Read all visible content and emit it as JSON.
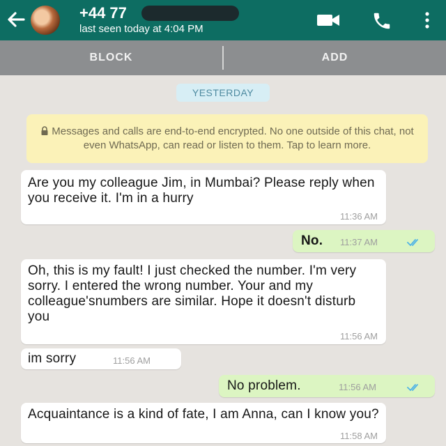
{
  "header": {
    "contact_name": "+44 77",
    "last_seen": "last seen today at 4:04 PM",
    "background_color": "#0d6d62",
    "icons": [
      "back-arrow-icon",
      "video-call-icon",
      "phone-icon",
      "more-vert-icon"
    ]
  },
  "actions": {
    "block_label": "BLOCK",
    "add_label": "ADD"
  },
  "chat": {
    "date_divider": "YESTERDAY",
    "encryption_notice": "Messages and calls are end-to-end encrypted. No one outside of this chat, not even WhatsApp, can read or listen to them. Tap to learn more.",
    "messages": [
      {
        "direction": "incoming",
        "text": "Are you my colleague Jim, in Mumbai? Please reply when you receive it. I'm in a hurry",
        "time": "11:36 AM"
      },
      {
        "direction": "outgoing",
        "text": "No.",
        "time": "11:37 AM",
        "status": "read"
      },
      {
        "direction": "incoming",
        "text": "Oh, this is my fault! I just checked the number. I'm very sorry. I entered the wrong number. Your and my colleague'snumbers are similar. Hope it doesn't disturb you",
        "time": "11:56 AM"
      },
      {
        "direction": "incoming",
        "text": "im sorry",
        "time": "11:56 AM"
      },
      {
        "direction": "outgoing",
        "text": "No problem.",
        "time": "11:56 AM",
        "status": "read"
      },
      {
        "direction": "incoming",
        "text": "Acquaintance is a kind of fate, I am Anna, can I know you?",
        "time": "11:58 AM"
      }
    ]
  },
  "colors": {
    "incoming_bubble": "#ffffff",
    "outgoing_bubble": "#dcf5c2",
    "read_ticks": "#4fb3e6",
    "notice_background": "#fbf2b8"
  }
}
